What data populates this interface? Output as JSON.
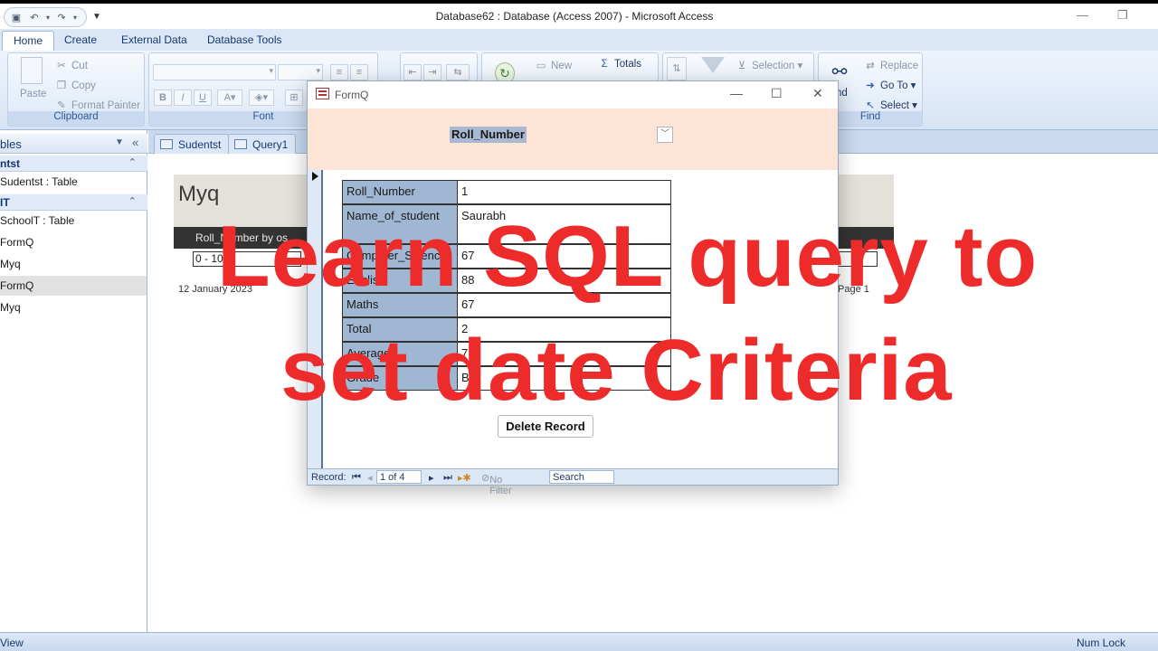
{
  "window": {
    "title": "Database62 : Database (Access 2007)  -  Microsoft Access",
    "minimize_glyph": "—",
    "restore_glyph": "❐"
  },
  "ribbon_tabs": [
    "Home",
    "Create",
    "External Data",
    "Database Tools"
  ],
  "ribbon": {
    "clipboard": {
      "label": "Clipboard",
      "paste": "Paste",
      "cut": "Cut",
      "copy": "Copy",
      "format_painter": "Format Painter"
    },
    "font": {
      "label": "Font"
    },
    "records": {
      "new": "New",
      "totals": "Totals"
    },
    "sort_filter": {
      "selection": "Selection"
    },
    "find": {
      "label": "Find",
      "find_fragment": "nd",
      "replace": "Replace",
      "go_to": "Go To",
      "select": "Select"
    }
  },
  "nav_pane": {
    "header": "bles",
    "groups": [
      {
        "title": "ntst",
        "items": [
          "Sudentst : Table"
        ]
      },
      {
        "title": "IT",
        "items": [
          "SchoolT : Table",
          "FormQ",
          "Myq",
          "FormQ",
          "Myq"
        ]
      }
    ]
  },
  "doc_tabs": [
    "Sudentst",
    "Query1"
  ],
  "report": {
    "title": "Myq",
    "column_header": "Roll_Number by os",
    "first_value": "0 - 10",
    "date": "12 January 2023",
    "page": "Page 1"
  },
  "formq": {
    "title": "FormQ",
    "combo_label": "Roll_Number",
    "fields": [
      {
        "label": "Roll_Number",
        "value": "1"
      },
      {
        "label": "Name_of_student",
        "value": "Saurabh"
      },
      {
        "label": "Computer_Science",
        "value": "67"
      },
      {
        "label": "English",
        "value": "88"
      },
      {
        "label": "Maths",
        "value": "67"
      },
      {
        "label": "Total",
        "value": "2"
      },
      {
        "label": "Average",
        "value": "7"
      },
      {
        "label": "Grade",
        "value": "B"
      }
    ],
    "delete_button": "Delete Record",
    "nav": {
      "record_label": "Record:",
      "position": "1 of 4",
      "filter": "No Filter",
      "search": "Search"
    }
  },
  "status_bar": {
    "left": "View",
    "right": "Num Lock"
  },
  "overlay": {
    "line1": "Learn SQL query to",
    "line2": "set date Criteria"
  },
  "colors": {
    "overlay_text": "#ee2b2b",
    "form_header": "#fce4d6",
    "label_fill": "#9fb7d3",
    "ribbon_blue": "#dbe7f6"
  }
}
